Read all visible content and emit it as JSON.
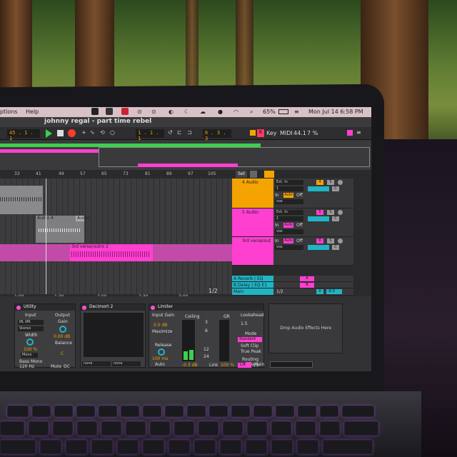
{
  "menubar": {
    "items": [
      "ptions",
      "Help"
    ],
    "battery": "65%",
    "datetime": "Mon Jul 14  6:58 PM"
  },
  "window": {
    "title": "johnny regal - part time rebel"
  },
  "transport": {
    "position": "45 .  1 .  1",
    "loop_start": "1 .  1 .  1",
    "loop_length": "6 .  3 .  3",
    "key_label": "Key",
    "midi_label": "MIDI",
    "sample_rate": "44.1",
    "cpu": "7 %"
  },
  "ruler": {
    "bars": [
      "33",
      "41",
      "49",
      "57",
      "65",
      "73",
      "81",
      "89",
      "97",
      "105"
    ],
    "set_label": "Set"
  },
  "time_ruler": [
    "1:00",
    "1:30",
    "2:00",
    "2:30",
    "3:00"
  ],
  "clips": {
    "audio4": "Audio 4",
    "audio": "Audio",
    "verse": "3rd verse/outro 2"
  },
  "tracks": [
    {
      "name": "4 Audio",
      "color": "#f5a300",
      "input": "Ext. In",
      "channel": "1",
      "monitor": [
        "In",
        "Auto",
        "Off"
      ],
      "route": "vox",
      "num": "4",
      "s": "S",
      "c": "C"
    },
    {
      "name": "5 Audio",
      "color": "#ff3fd0",
      "input": "Ext. In",
      "channel": "1",
      "monitor": [
        "In",
        "Auto",
        "Off"
      ],
      "route": "vox",
      "num": "5",
      "s": "S",
      "c": "C"
    },
    {
      "name": "3rd verse/out",
      "color": "#ff3fd0",
      "input": "",
      "channel": "",
      "monitor": [
        "In",
        "Auto",
        "Off"
      ],
      "route": "vox",
      "num": "6",
      "s": "S",
      "c": "C"
    }
  ],
  "returns": [
    {
      "name": "A Reverb | EQ",
      "letter": "A"
    },
    {
      "name": "B Delay | EQ E1",
      "letter": "B"
    }
  ],
  "main": {
    "name": "Main",
    "fraction": "1/2",
    "value": "0",
    "level": "-6.0"
  },
  "ruler_fraction": "1/2",
  "devices": {
    "utility": {
      "title": "Utility",
      "input": "Input",
      "output": "Output",
      "gain": "Gain",
      "gain_value": "0.00 dB",
      "width": "Width",
      "width_value": "100 %",
      "stereo": "Stereo",
      "mono": "Mono",
      "balance": "Balance",
      "balance_value": "C",
      "bass_mono": "Bass Mono",
      "bass_freq": "120 Hz",
      "mute": "Mute",
      "dc": "DC"
    },
    "decimort": {
      "title": "Decimort 2",
      "none1": "none",
      "none2": "none"
    },
    "limiter": {
      "title": "Limiter",
      "input_gain": "Input Gain",
      "input_gain_value": "0.0 dB",
      "maximize": "Maximize",
      "release": "Release",
      "release_value": "100 ms",
      "auto": "Auto",
      "ceiling": "Ceiling",
      "gr": "GR",
      "ceiling_value": "-0.3 dB",
      "scale": [
        "3",
        "6",
        "12",
        "24"
      ],
      "link": "Link",
      "link_value": "100 %",
      "lookahead": "Lookahead",
      "lookahead_value": "1.5",
      "mode": "Mode",
      "mode_value": "Standard",
      "soft_clip": "Soft Clip",
      "true_peak": "True Peak",
      "routing": "Routing",
      "routing_lr": "L/R",
      "routing_ms": "M/S"
    },
    "drop_zone": "Drop Audio Effects Here"
  },
  "statusbar": {
    "main": "Main"
  },
  "colors": {
    "accent_pink": "#ff3fd0",
    "accent_orange": "#f5a300",
    "play_green": "#3cd04c",
    "record_red": "#ff3b30"
  }
}
